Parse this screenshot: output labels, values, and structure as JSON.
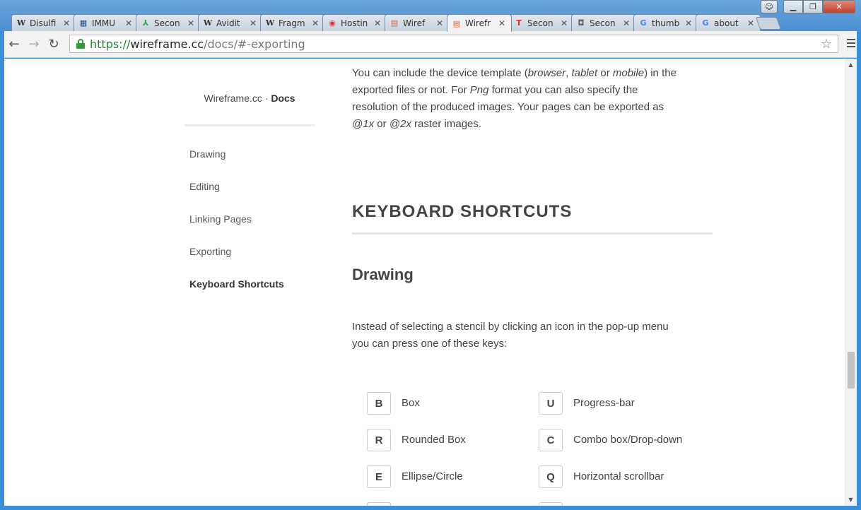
{
  "browser": {
    "tabs": [
      {
        "icon": "W",
        "title": "Disulfi"
      },
      {
        "icon": "▦",
        "title": "IMMU"
      },
      {
        "icon": "⅄",
        "title": "Secon"
      },
      {
        "icon": "W",
        "title": "Avidit"
      },
      {
        "icon": "W",
        "title": "Fragm"
      },
      {
        "icon": "◉",
        "title": "Hostin"
      },
      {
        "icon": "▤",
        "title": "Wiref"
      },
      {
        "icon": "▤",
        "title": "Wirefr"
      },
      {
        "icon": "T",
        "title": "Secon"
      },
      {
        "icon": "◘",
        "title": "Secon"
      },
      {
        "icon": "G",
        "title": "thumb"
      },
      {
        "icon": "G",
        "title": "about"
      }
    ],
    "url": {
      "scheme": "https://",
      "host": "wireframe.cc",
      "path": "/docs/#-exporting"
    }
  },
  "sidebar": {
    "brand": "Wireframe.cc · ",
    "brand_bold": "Docs",
    "items": [
      {
        "label": "Drawing"
      },
      {
        "label": "Editing"
      },
      {
        "label": "Linking Pages"
      },
      {
        "label": "Exporting"
      },
      {
        "label": "Keyboard Shortcuts"
      }
    ]
  },
  "content": {
    "export_para": {
      "t1": "You can include the device template (",
      "browser": "browser",
      "t2": ", ",
      "tablet": "tablet",
      "t3": " or ",
      "mobile": "mobile",
      "t4": ") in the exported files or not. For ",
      "png": "Png",
      "t5": " format you can also specify the resolution of the produced images. Your pages can be exported as ",
      "x1": "@1x",
      "t6": " or ",
      "x2": "@2x",
      "t7": " raster images."
    },
    "section_title": "KEYBOARD SHORTCUTS",
    "subsection_title": "Drawing",
    "intro": "Instead of selecting a stencil by clicking an icon in the pop-up menu you can press one of these keys:",
    "shortcuts_left": [
      {
        "key": "B",
        "label": "Box"
      },
      {
        "key": "R",
        "label": "Rounded Box"
      },
      {
        "key": "E",
        "label": "Ellipse/Circle"
      }
    ],
    "shortcuts_right": [
      {
        "key": "U",
        "label": "Progress-bar"
      },
      {
        "key": "C",
        "label": "Combo box/Drop-down"
      },
      {
        "key": "Q",
        "label": "Horizontal scrollbar"
      }
    ]
  }
}
